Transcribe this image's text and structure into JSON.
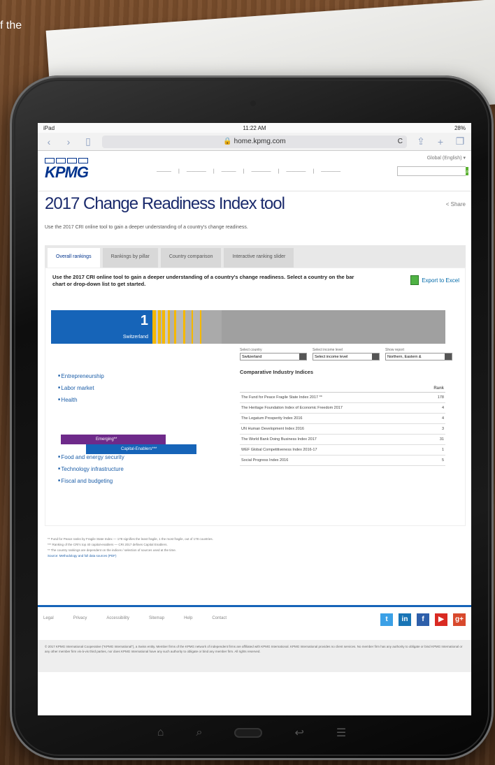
{
  "background": {
    "page_fragment": "f the"
  },
  "status_bar": {
    "left": "iPad",
    "time": "11:22 AM",
    "battery": "28%"
  },
  "browser": {
    "url": "home.kpmg.com",
    "reload": "C"
  },
  "site": {
    "logo": "KPMG",
    "lang": "Global (English)"
  },
  "page": {
    "title": "2017 Change Readiness Index tool",
    "share": "Share",
    "intro": "Use the 2017 CRI online tool to gain a deeper understanding of a country's change readiness.",
    "tabs": [
      "Overall rankings",
      "Rankings by pillar",
      "Country comparison",
      "Interactive ranking slider"
    ],
    "lead": "Use the 2017 CRI online tool to gain a deeper understanding of a country's change readiness. Select a country on the bar chart or drop-down list to get started.",
    "export": "Export to Excel"
  },
  "rank_bar": {
    "rank": "1",
    "country": "Switzerland",
    "stripes": [
      {
        "color": "#f5b800",
        "w": 5
      },
      {
        "color": "#c8c8c8",
        "w": 3
      },
      {
        "color": "#f5b800",
        "w": 4
      },
      {
        "color": "#b6b6b6",
        "w": 2
      },
      {
        "color": "#f5b800",
        "w": 5
      },
      {
        "color": "#c8c8c8",
        "w": 4
      },
      {
        "color": "#f5b800",
        "w": 3
      },
      {
        "color": "#b0b0b0",
        "w": 6
      },
      {
        "color": "#f5b800",
        "w": 3
      },
      {
        "color": "#b8b8b8",
        "w": 10
      },
      {
        "color": "#f5b800",
        "w": 3
      },
      {
        "color": "#b0b0b0",
        "w": 10
      },
      {
        "color": "#f5b800",
        "w": 2
      },
      {
        "color": "#b5b5b5",
        "w": 10
      },
      {
        "color": "#f5b800",
        "w": 2
      },
      {
        "color": "#aaaaaa",
        "w": 30
      },
      {
        "color": "#a0a0a0",
        "w": 330
      }
    ]
  },
  "selectors": [
    {
      "label": "Select country",
      "value": "Switzerland"
    },
    {
      "label": "Select income level",
      "value": "Select income level"
    },
    {
      "label": "Show report",
      "value": "Northern, Eastern &"
    }
  ],
  "pillars_top": [
    "Entrepreneurship",
    "Labor market",
    "Health"
  ],
  "tags": {
    "emerging": "Emerging**",
    "capital": "Capital-Enablers***"
  },
  "pillars_bottom": [
    "Food and energy security",
    "Technology infrastructure",
    "Fiscal and budgeting"
  ],
  "cit": {
    "title": "Comparative Industry Indices",
    "col_rank": "Rank",
    "rows": [
      {
        "name": "The Fund for Peace Fragile State Index 2017 **",
        "rank": "178"
      },
      {
        "name": "The Heritage Foundation Index of Economic Freedom 2017",
        "rank": "4"
      },
      {
        "name": "The Legatum Prosperity Index 2016",
        "rank": "4"
      },
      {
        "name": "UN Human Development Index 2016",
        "rank": "3"
      },
      {
        "name": "The World Bank Doing Business Index 2017",
        "rank": "31"
      },
      {
        "name": "WEF Global Competitiveness Index 2016-17",
        "rank": "1"
      },
      {
        "name": "Social Progress Index 2016",
        "rank": "5"
      }
    ]
  },
  "notes": [
    "** Fund for Peace ranks by Fragile State Index — 178 signifies the least fragile, 1 the most fragile, out of 178 countries.",
    "*** Ranking of the CRI's top 40 capital-enablers — CRI 2017 defines Capital Enablers.",
    "** The country rankings are dependent on the indices / selection of sources used at the time.",
    "Source: Methodology and full data sources (PDF)"
  ],
  "footer": {
    "links": [
      "Legal",
      "Privacy",
      "Accessibility",
      "Sitemap",
      "Help",
      "Contact"
    ],
    "social": [
      {
        "name": "twitter",
        "glyph": "t",
        "color": "#3ba0e6"
      },
      {
        "name": "linkedin",
        "glyph": "in",
        "color": "#1874b5"
      },
      {
        "name": "facebook",
        "glyph": "f",
        "color": "#2e5faa"
      },
      {
        "name": "youtube",
        "glyph": "▶",
        "color": "#d92a22"
      },
      {
        "name": "googleplus",
        "glyph": "g+",
        "color": "#d8492d"
      }
    ],
    "legal": "© 2017 KPMG International Cooperative (\"KPMG International\"), a Swiss entity. Member firms of the KPMG network of independent firms are affiliated with KPMG International. KPMG International provides no client services. No member firm has any authority to obligate or bind KPMG International or any other member firm vis-à-vis third parties, nor does KPMG International have any such authority to obligate or bind any member firm. All rights reserved."
  }
}
